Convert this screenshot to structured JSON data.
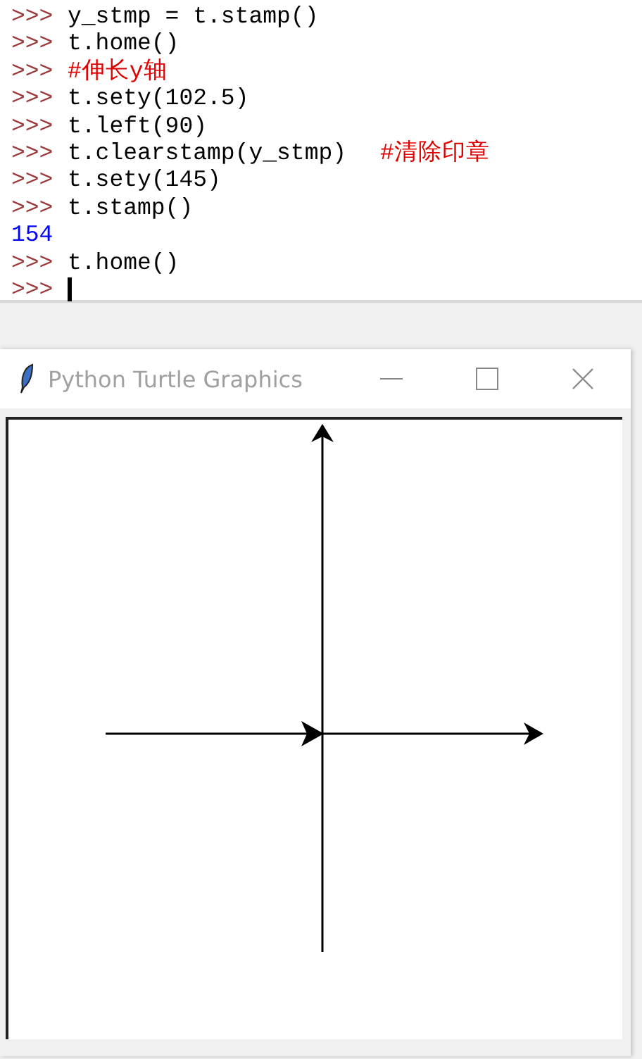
{
  "shell": {
    "lines": [
      {
        "prompt": ">>>",
        "parts": [
          {
            "kind": "code",
            "text": "y_stmp = t.stamp()"
          }
        ]
      },
      {
        "prompt": ">>>",
        "parts": [
          {
            "kind": "code",
            "text": "t.home()"
          }
        ]
      },
      {
        "prompt": ">>>",
        "parts": [
          {
            "kind": "comment",
            "text": "#伸长y轴"
          }
        ]
      },
      {
        "prompt": ">>>",
        "parts": [
          {
            "kind": "code",
            "text": "t.sety(102.5)"
          }
        ]
      },
      {
        "prompt": ">>>",
        "parts": [
          {
            "kind": "code",
            "text": "t.left(90)"
          }
        ]
      },
      {
        "prompt": ">>>",
        "parts": [
          {
            "kind": "code",
            "text": "t.clearstamp(y_stmp)"
          },
          {
            "kind": "comment",
            "text": "#清除印章"
          }
        ]
      },
      {
        "prompt": ">>>",
        "parts": [
          {
            "kind": "code",
            "text": "t.sety(145)"
          }
        ]
      },
      {
        "prompt": ">>>",
        "parts": [
          {
            "kind": "code",
            "text": "t.stamp()"
          }
        ]
      },
      {
        "parts": [
          {
            "kind": "output",
            "text": "154"
          }
        ]
      },
      {
        "prompt": ">>>",
        "parts": [
          {
            "kind": "code",
            "text": "t.home()"
          }
        ]
      },
      {
        "prompt": ">>>",
        "cursor": true
      }
    ]
  },
  "turtle_window": {
    "title": "Python Turtle Graphics"
  }
}
